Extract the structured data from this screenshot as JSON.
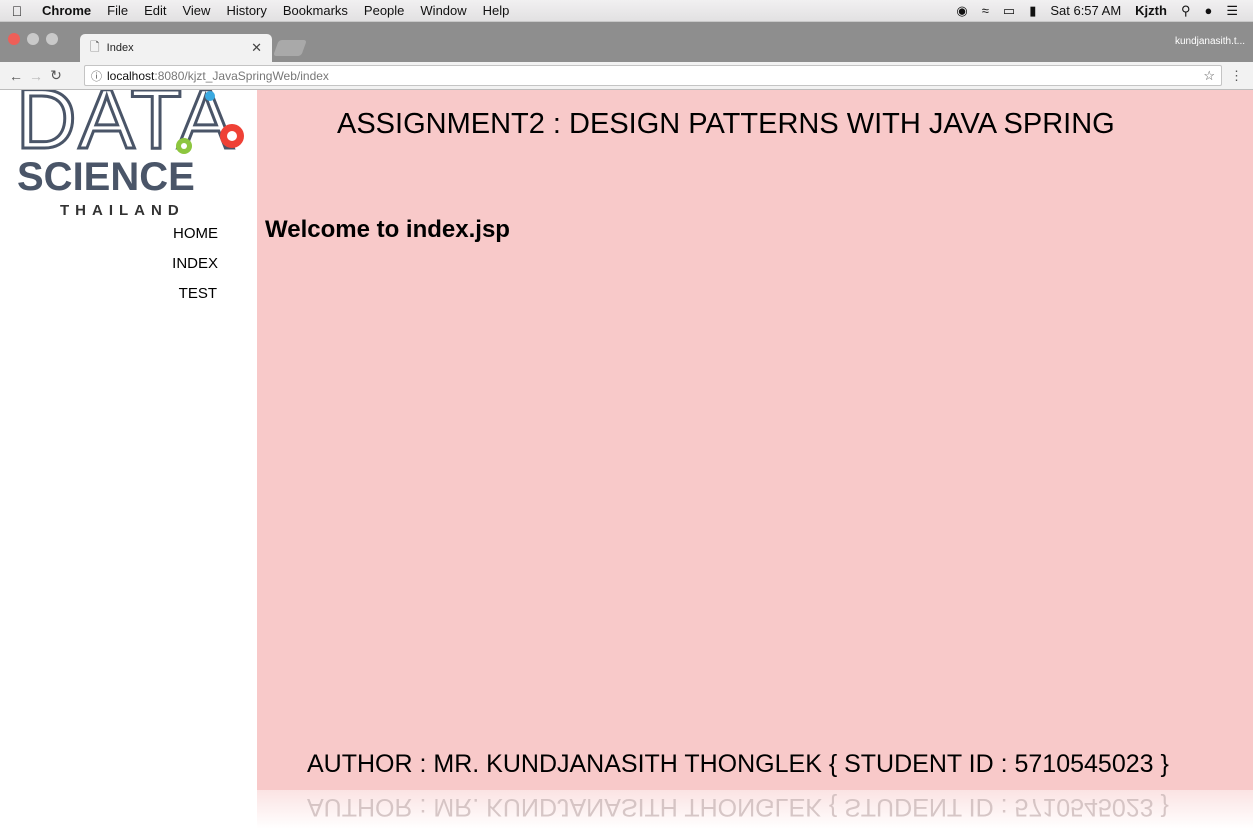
{
  "menubar": {
    "app": "Chrome",
    "items": [
      "File",
      "Edit",
      "View",
      "History",
      "Bookmarks",
      "People",
      "Window",
      "Help"
    ],
    "clock": "Sat 6:57 AM",
    "user": "Kjzth"
  },
  "browser": {
    "tab_title": "Index",
    "profile": "kundjanasith.t...",
    "url_host": "localhost",
    "url_path": ":8080/kjzt_JavaSpringWeb/index"
  },
  "logo": {
    "top": "DATA",
    "middle": "SCIENCE",
    "bottom": "THAILAND",
    "colors": {
      "text": "#4a5568",
      "green": "#8dc63f",
      "red": "#ef4136",
      "blue": "#3aa9e0"
    }
  },
  "nav": {
    "home": "HOME",
    "index": "INDEX",
    "test": "TEST"
  },
  "page": {
    "title": "ASSIGNMENT2 : DESIGN PATTERNS WITH JAVA SPRING",
    "welcome": "Welcome to index.jsp",
    "footer": "AUTHOR : MR. KUNDJANASITH THONGLEK { STUDENT ID : 5710545023 }",
    "background": "#f8c9c9"
  }
}
